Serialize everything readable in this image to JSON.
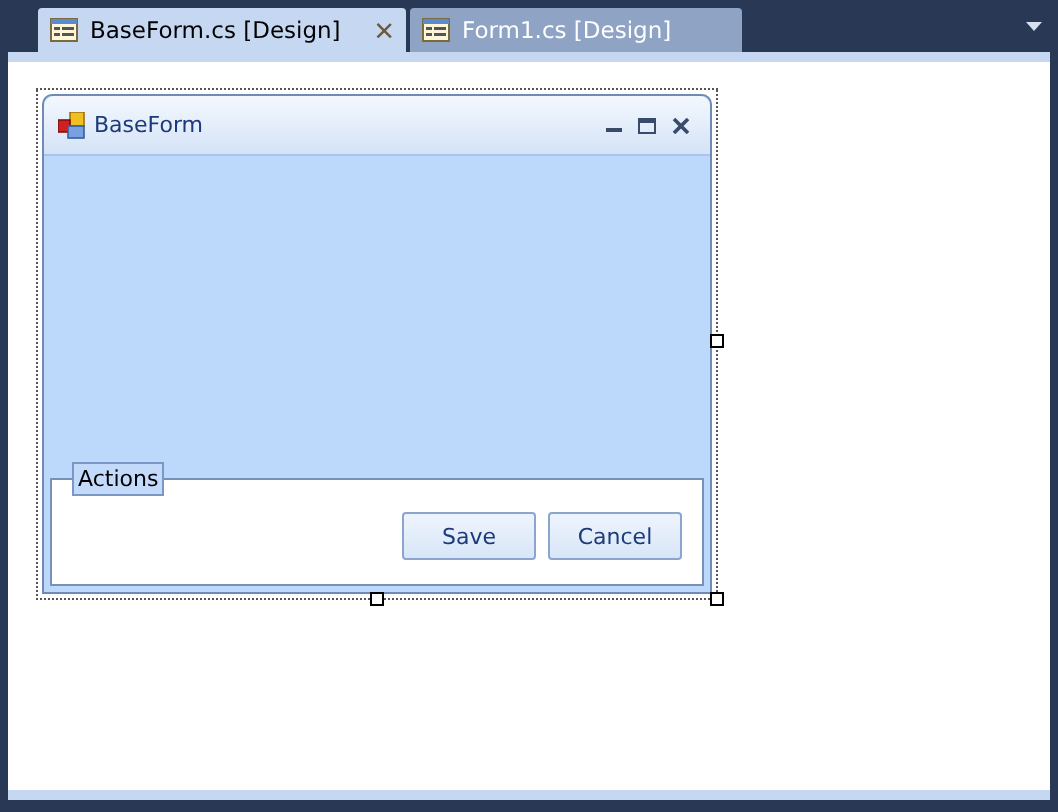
{
  "tabs": [
    {
      "label": "BaseForm.cs [Design]",
      "selected": true,
      "close": "×"
    },
    {
      "label": "Form1.cs [Design]",
      "selected": false
    }
  ],
  "form": {
    "title": "BaseForm"
  },
  "group": {
    "label": "Actions"
  },
  "buttons": [
    "Save",
    "Cancel"
  ]
}
